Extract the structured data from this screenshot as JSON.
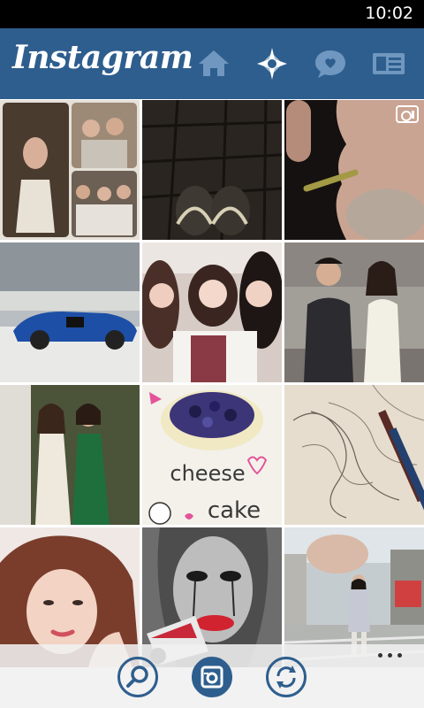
{
  "status_bar": {
    "time": "10:02"
  },
  "header": {
    "title": "Instagram",
    "icons": [
      "home-icon",
      "explore-star-icon",
      "news-speech-bubble-icon",
      "profile-card-icon"
    ]
  },
  "grid": {
    "tiles": [
      {
        "name": "photo-collage",
        "color": "#c9b49a"
      },
      {
        "name": "photo-shoes-floor",
        "color": "#2a2520"
      },
      {
        "name": "photo-mouth-video",
        "color": "#1b1715",
        "video": true
      },
      {
        "name": "photo-blue-sports-car",
        "color": "#9aa2a8"
      },
      {
        "name": "photo-group-selfie",
        "color": "#c7a9a4"
      },
      {
        "name": "photo-couple-street",
        "color": "#6d6a66"
      },
      {
        "name": "photo-two-women-dresses",
        "color": "#59603f"
      },
      {
        "name": "photo-cheese-cake",
        "color": "#f1efe8"
      },
      {
        "name": "photo-sketch-drawing",
        "color": "#ded3c2"
      },
      {
        "name": "photo-woman-portrait",
        "color": "#a27062"
      },
      {
        "name": "photo-graffiti-face",
        "color": "#5a5a5a"
      },
      {
        "name": "photo-street-walk",
        "color": "#a6b2bc"
      }
    ],
    "cake_text_1": "cheese",
    "cake_text_2": "cake"
  },
  "app_bar": {
    "buttons": [
      "search-icon",
      "camera-icon",
      "refresh-icon"
    ],
    "more": "more-options-icon",
    "accent": "#2e5e8e"
  }
}
